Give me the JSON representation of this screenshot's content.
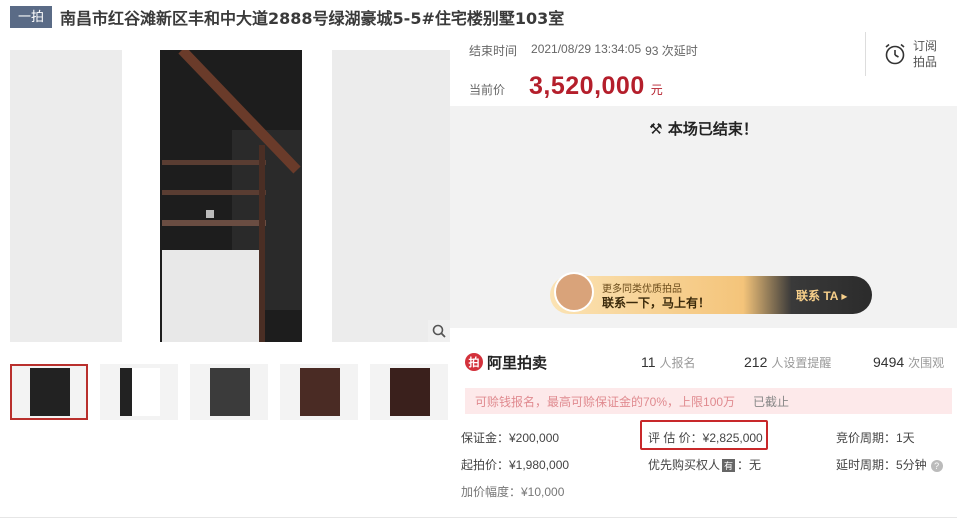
{
  "title": {
    "badge": "一拍",
    "text": "南昌市红谷滩新区丰和中大道2888号绿湖豪城5-5#住宅楼别墅103室"
  },
  "auction": {
    "end_label": "结束时间",
    "end_time": "2021/08/29 13:34:05",
    "delays": "93 次延时",
    "price_label": "当前价",
    "price": "3,520,000",
    "currency": "元",
    "subscribe": "订阅拍品",
    "ended_text": "本场已结束！"
  },
  "promo": {
    "small": "更多同类优质拍品",
    "big": "联系一下，马上有！",
    "cta": "联系 TA ▸"
  },
  "stats": {
    "logo_text": "阿里拍卖",
    "registered_num": "11",
    "registered_label": "人报名",
    "reminders_num": "212",
    "reminders_label": "人设置提醒",
    "views_num": "9494",
    "views_label": "次围观"
  },
  "notice": {
    "text": "可赊钱报名，最高可赊保证金的70%，上限100万",
    "status": "已截止"
  },
  "details": {
    "deposit": "保证金：¥200,000",
    "start_price": "起拍价：¥1,980,000",
    "increment": "加价幅度：¥10,000",
    "appraisal": "评 估 价：¥2,825,000",
    "priority_prefix": "优先购买权人",
    "priority_tag": "有",
    "priority_suffix": "：无",
    "bid_cycle": "竞价周期：1天",
    "delay_cycle": "延时周期：5分钟"
  },
  "colors": {
    "price_red": "#b41e2b",
    "badge_bg": "#5a6b86",
    "highlight": "#c8282a"
  }
}
